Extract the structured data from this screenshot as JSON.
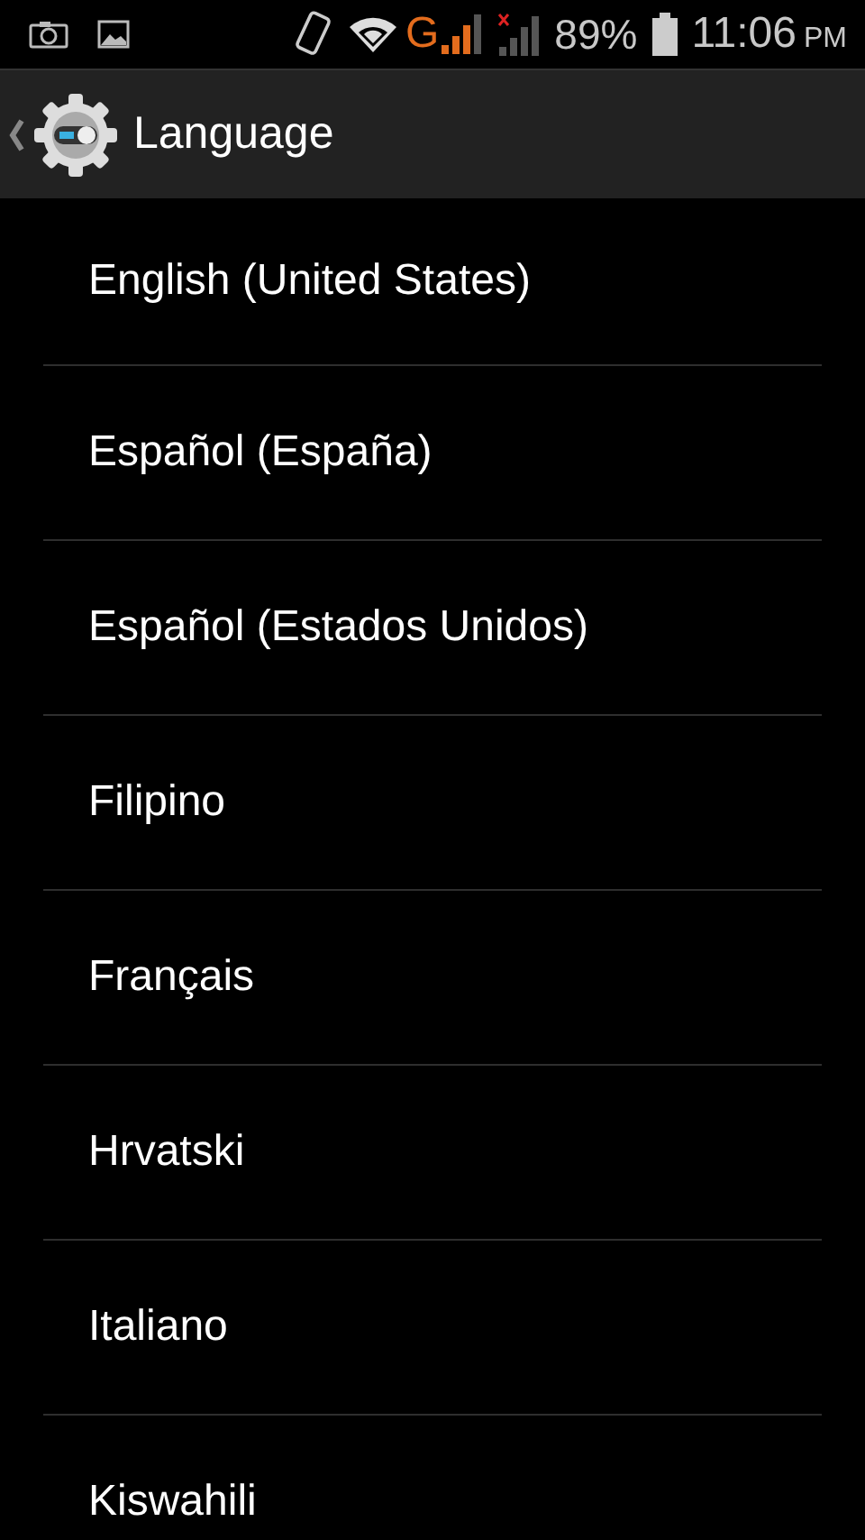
{
  "status_bar": {
    "network_type": "G",
    "battery": "89%",
    "time": "11:06",
    "meridiem": "PM"
  },
  "action_bar": {
    "title": "Language"
  },
  "languages": [
    {
      "label": "English (United States)"
    },
    {
      "label": "Español (España)"
    },
    {
      "label": "Español (Estados Unidos)"
    },
    {
      "label": "Filipino"
    },
    {
      "label": "Français"
    },
    {
      "label": "Hrvatski"
    },
    {
      "label": "Italiano"
    },
    {
      "label": "Kiswahili"
    }
  ]
}
